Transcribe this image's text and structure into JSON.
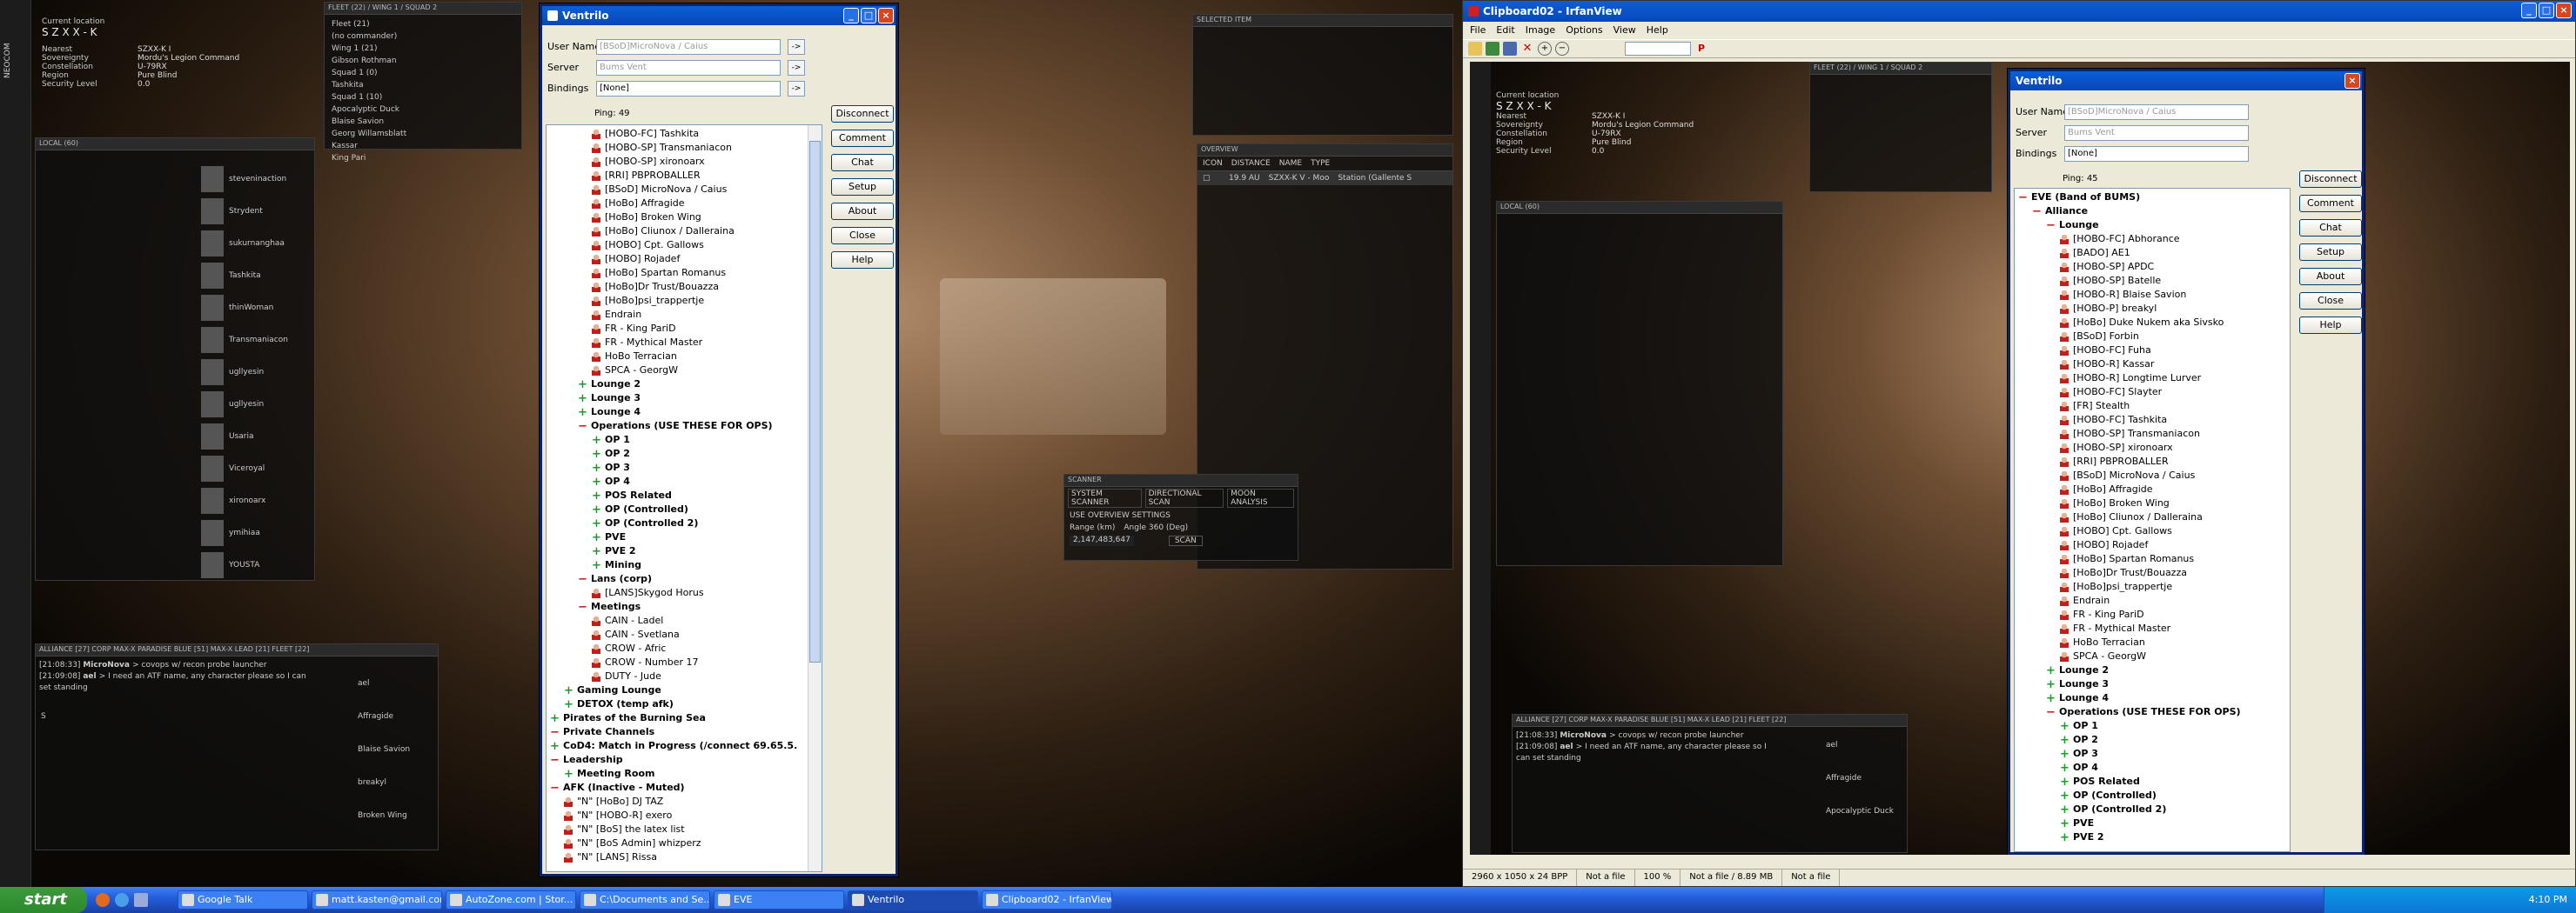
{
  "game": {
    "location_label": "Current location",
    "location_value": "S Z X X - K",
    "info_rows": [
      {
        "label": "Nearest",
        "value": "SZXX-K I"
      },
      {
        "label": "Sovereignty",
        "value": "Mordu's Legion Command"
      },
      {
        "label": "Constellation",
        "value": "U-79RX"
      },
      {
        "label": "Region",
        "value": "Pure Blind"
      },
      {
        "label": "Security Level",
        "value": "0.0"
      }
    ],
    "side_label": "NEOCOM",
    "fleet_title": "FLEET (22) / WING 1 / SQUAD 2",
    "fleet_rows": [
      "Fleet (21)",
      "(no commander)",
      "Wing 1 (21)",
      "Gibson Rothman",
      "Squad 1 (0)",
      "Tashkita",
      "Squad 1 (10)",
      "Apocalyptic Duck",
      "Blaise Savion",
      "Georg Willamsblatt",
      "Kassar",
      "King Pari"
    ],
    "local_title": "LOCAL (60)",
    "local_members": [
      "steveninaction",
      "Strydent",
      "sukurnanghaa",
      "Tashkita",
      "thinWoman",
      "Transmaniacon",
      "ugllyesin",
      "ugllyesin",
      "Usaria",
      "Viceroyal",
      "xironoarx",
      "ymihiaa",
      "YOUSTA"
    ],
    "chat_tabs": "ALLIANCE [27]  CORP  MAX-X  PARADISE BLUE [51]  MAX-X LEAD [21]  FLEET [22]",
    "chat_lines": [
      {
        "time": "[21:08:33]",
        "speaker": "MicroNova",
        "text": "> covops w/ recon probe launcher"
      },
      {
        "time": "[21:09:08]",
        "speaker": "ael",
        "text": "> I need an ATF name, any character please so I can set standing"
      }
    ],
    "chat_prompt": "S",
    "fleet_chat_members": [
      "ael",
      "Affragide",
      "Blaise Savion",
      "breakyl",
      "Broken Wing"
    ],
    "fleet_chat_members_copy": [
      "ael",
      "Affragide",
      "Apocalyptic Duck"
    ],
    "selected_item_title": "SELECTED ITEM",
    "overview_title": "OVERVIEW",
    "overview_cols": [
      "ICON",
      "DISTANCE",
      "NAME",
      "TYPE"
    ],
    "overview_row": {
      "distance": "19.9 AU",
      "name": "SZXX-K V - Moo",
      "type": "Station (Gallente S"
    },
    "scanner_title": "SCANNER",
    "scanner_tabs": [
      "SYSTEM SCANNER",
      "DIRECTIONAL SCAN",
      "MOON ANALYSIS"
    ],
    "scanner_use_overview": "USE OVERVIEW SETTINGS",
    "scanner_range_label": "Range (km)",
    "scanner_range_value": "2,147,483,647",
    "scanner_angle": "Angle 360 (Deg)",
    "scanner_scan": "SCAN"
  },
  "ventrilo": {
    "title": "Ventrilo",
    "user_name_label": "User Name",
    "user_name_value": "[BSoD]MicroNova / Caius",
    "server_label": "Server",
    "server_value": "Bums Vent",
    "bindings_label": "Bindings",
    "bindings_value": "[None]",
    "ping": "Ping: 49",
    "buttons": [
      "Disconnect",
      "Comment",
      "Chat",
      "Setup",
      "About",
      "Close",
      "Help"
    ],
    "tree": [
      {
        "type": "user",
        "indent": 3,
        "text": "[HOBO-FC] Tashkita"
      },
      {
        "type": "user",
        "indent": 3,
        "text": "[HOBO-SP] Transmaniacon"
      },
      {
        "type": "user",
        "indent": 3,
        "text": "[HOBO-SP] xironoarx"
      },
      {
        "type": "user",
        "indent": 3,
        "text": "[RRI] PBPROBALLER"
      },
      {
        "type": "user",
        "indent": 3,
        "text": "[BSoD] MicroNova / Caius"
      },
      {
        "type": "user",
        "indent": 3,
        "text": "[HoBo] Affragide"
      },
      {
        "type": "user",
        "indent": 3,
        "text": "[HoBo] Broken Wing"
      },
      {
        "type": "user",
        "indent": 3,
        "text": "[HoBo] Cliunox / Dalleraina"
      },
      {
        "type": "user",
        "indent": 3,
        "text": "[HOBO] Cpt. Gallows"
      },
      {
        "type": "user",
        "indent": 3,
        "text": "[HOBO] Rojadef"
      },
      {
        "type": "user",
        "indent": 3,
        "text": "[HoBo] Spartan Romanus"
      },
      {
        "type": "user",
        "indent": 3,
        "text": "[HoBo]Dr Trust/Bouazza"
      },
      {
        "type": "user",
        "indent": 3,
        "text": "[HoBo]psi_trappertje"
      },
      {
        "type": "user",
        "indent": 3,
        "text": "Endrain"
      },
      {
        "type": "user",
        "indent": 3,
        "text": "FR - King PariD"
      },
      {
        "type": "user",
        "indent": 3,
        "text": "FR - Mythical Master"
      },
      {
        "type": "user",
        "indent": 3,
        "text": "HoBo Terracian"
      },
      {
        "type": "user",
        "indent": 3,
        "text": "SPCA - GeorgW"
      },
      {
        "type": "plus",
        "indent": 2,
        "text": "Lounge 2"
      },
      {
        "type": "plus",
        "indent": 2,
        "text": "Lounge 3"
      },
      {
        "type": "plus",
        "indent": 2,
        "text": "Lounge 4"
      },
      {
        "type": "minus",
        "indent": 2,
        "text": "Operations (USE THESE FOR OPS)"
      },
      {
        "type": "plus",
        "indent": 3,
        "text": "OP 1"
      },
      {
        "type": "plus",
        "indent": 3,
        "text": "OP 2"
      },
      {
        "type": "plus",
        "indent": 3,
        "text": "OP 3"
      },
      {
        "type": "plus",
        "indent": 3,
        "text": "OP 4"
      },
      {
        "type": "plus",
        "indent": 3,
        "text": "POS Related"
      },
      {
        "type": "plus",
        "indent": 3,
        "text": "OP (Controlled)"
      },
      {
        "type": "plus",
        "indent": 3,
        "text": "OP (Controlled 2)"
      },
      {
        "type": "plus",
        "indent": 3,
        "text": "PVE"
      },
      {
        "type": "plus",
        "indent": 3,
        "text": "PVE 2"
      },
      {
        "type": "plus",
        "indent": 3,
        "text": "Mining"
      },
      {
        "type": "minus",
        "indent": 2,
        "text": "Lans (corp)"
      },
      {
        "type": "user",
        "indent": 3,
        "text": "[LANS]Skygod Horus"
      },
      {
        "type": "minus",
        "indent": 2,
        "text": "Meetings"
      },
      {
        "type": "user",
        "indent": 3,
        "text": "CAIN - Ladel"
      },
      {
        "type": "user",
        "indent": 3,
        "text": "CAIN - Svetlana"
      },
      {
        "type": "user",
        "indent": 3,
        "text": "CROW - Afric"
      },
      {
        "type": "user",
        "indent": 3,
        "text": "CROW - Number 17"
      },
      {
        "type": "user",
        "indent": 3,
        "text": "DUTY - Jude"
      },
      {
        "type": "plus",
        "indent": 1,
        "text": "Gaming Lounge"
      },
      {
        "type": "plus",
        "indent": 1,
        "text": "DETOX (temp afk)"
      },
      {
        "type": "plus",
        "indent": 0,
        "text": "Pirates of the Burning Sea"
      },
      {
        "type": "minus",
        "indent": 0,
        "text": "Private Channels"
      },
      {
        "type": "plus",
        "indent": 0,
        "text": "CoD4: Match in Progress (/connect 69.65.5."
      },
      {
        "type": "minus",
        "indent": 0,
        "text": "Leadership"
      },
      {
        "type": "plus",
        "indent": 1,
        "text": "Meeting Room"
      },
      {
        "type": "minus",
        "indent": 0,
        "text": "AFK (Inactive - Muted)"
      },
      {
        "type": "user",
        "indent": 1,
        "text": "\"N\" [HoBo] DJ TAZ"
      },
      {
        "type": "user",
        "indent": 1,
        "text": "\"N\" [HOBO-R] exero"
      },
      {
        "type": "user",
        "indent": 1,
        "text": "\"N\" [BoS] the latex list"
      },
      {
        "type": "user",
        "indent": 1,
        "text": "\"N\" [BoS Admin] whizperz"
      },
      {
        "type": "user",
        "indent": 1,
        "text": "\"N\" [LANS] Rissa"
      }
    ]
  },
  "ventrilo2": {
    "title": "Ventrilo",
    "ping": "Ping: 45",
    "tree": [
      {
        "type": "minus",
        "indent": 0,
        "text": "EVE (Band of BUMS)"
      },
      {
        "type": "minus",
        "indent": 1,
        "text": "Alliance"
      },
      {
        "type": "minus",
        "indent": 2,
        "text": "Lounge"
      },
      {
        "type": "user",
        "indent": 3,
        "text": "[HOBO-FC] Abhorance"
      },
      {
        "type": "user",
        "indent": 3,
        "text": "[BADO] AE1"
      },
      {
        "type": "user",
        "indent": 3,
        "text": "[HOBO-SP] APDC"
      },
      {
        "type": "user",
        "indent": 3,
        "text": "[HOBO-SP] Batelle"
      },
      {
        "type": "user",
        "indent": 3,
        "text": "[HOBO-R] Blaise Savion"
      },
      {
        "type": "user",
        "indent": 3,
        "text": "[HOBO-P] breakyl"
      },
      {
        "type": "user",
        "indent": 3,
        "text": "[HoBo] Duke Nukem aka Sivsko"
      },
      {
        "type": "user",
        "indent": 3,
        "text": "[BSoD] Forbin"
      },
      {
        "type": "user",
        "indent": 3,
        "text": "[HOBO-FC] Fuha"
      },
      {
        "type": "user",
        "indent": 3,
        "text": "[HOBO-R] Kassar"
      },
      {
        "type": "user",
        "indent": 3,
        "text": "[HOBO-R] Longtime Lurver"
      },
      {
        "type": "user",
        "indent": 3,
        "text": "[HOBO-FC] Slayter"
      },
      {
        "type": "user",
        "indent": 3,
        "text": "[FR] Stealth"
      },
      {
        "type": "user",
        "indent": 3,
        "text": "[HOBO-FC] Tashkita"
      },
      {
        "type": "user",
        "indent": 3,
        "text": "[HOBO-SP] Transmaniacon"
      },
      {
        "type": "user",
        "indent": 3,
        "text": "[HOBO-SP] xironoarx"
      },
      {
        "type": "user",
        "indent": 3,
        "text": "[RRI] PBPROBALLER"
      },
      {
        "type": "user",
        "indent": 3,
        "text": "[BSoD] MicroNova / Caius"
      },
      {
        "type": "user",
        "indent": 3,
        "text": "[HoBo] Affragide"
      },
      {
        "type": "user",
        "indent": 3,
        "text": "[HoBo] Broken Wing"
      },
      {
        "type": "user",
        "indent": 3,
        "text": "[HoBo] Cliunox / Dalleraina"
      },
      {
        "type": "user",
        "indent": 3,
        "text": "[HOBO] Cpt. Gallows"
      },
      {
        "type": "user",
        "indent": 3,
        "text": "[HOBO] Rojadef"
      },
      {
        "type": "user",
        "indent": 3,
        "text": "[HoBo] Spartan Romanus"
      },
      {
        "type": "user",
        "indent": 3,
        "text": "[HoBo]Dr Trust/Bouazza"
      },
      {
        "type": "user",
        "indent": 3,
        "text": "[HoBo]psi_trappertje"
      },
      {
        "type": "user",
        "indent": 3,
        "text": "Endrain"
      },
      {
        "type": "user",
        "indent": 3,
        "text": "FR - King PariD"
      },
      {
        "type": "user",
        "indent": 3,
        "text": "FR - Mythical Master"
      },
      {
        "type": "user",
        "indent": 3,
        "text": "HoBo Terracian"
      },
      {
        "type": "user",
        "indent": 3,
        "text": "SPCA - GeorgW"
      },
      {
        "type": "plus",
        "indent": 2,
        "text": "Lounge 2"
      },
      {
        "type": "plus",
        "indent": 2,
        "text": "Lounge 3"
      },
      {
        "type": "plus",
        "indent": 2,
        "text": "Lounge 4"
      },
      {
        "type": "minus",
        "indent": 2,
        "text": "Operations (USE THESE FOR OPS)"
      },
      {
        "type": "plus",
        "indent": 3,
        "text": "OP 1"
      },
      {
        "type": "plus",
        "indent": 3,
        "text": "OP 2"
      },
      {
        "type": "plus",
        "indent": 3,
        "text": "OP 3"
      },
      {
        "type": "plus",
        "indent": 3,
        "text": "OP 4"
      },
      {
        "type": "plus",
        "indent": 3,
        "text": "POS Related"
      },
      {
        "type": "plus",
        "indent": 3,
        "text": "OP (Controlled)"
      },
      {
        "type": "plus",
        "indent": 3,
        "text": "OP (Controlled 2)"
      },
      {
        "type": "plus",
        "indent": 3,
        "text": "PVE"
      },
      {
        "type": "plus",
        "indent": 3,
        "text": "PVE 2"
      }
    ]
  },
  "irfanview": {
    "title": "Clipboard02 - IrfanView",
    "menu": [
      "File",
      "Edit",
      "Image",
      "Options",
      "View",
      "Help"
    ],
    "status": [
      "2960 x 1050 x 24 BPP",
      "Not a file",
      "100 %",
      "Not a file / 8.89 MB",
      "Not a file"
    ]
  },
  "taskbar": {
    "start": "start",
    "items": [
      "Google Talk",
      "matt.kasten@gmail.com",
      "AutoZone.com | Stor...",
      "C:\\Documents and Se...",
      "EVE",
      "Ventrilo",
      "Clipboard02 - IrfanView"
    ],
    "clock": "4:10 PM"
  }
}
